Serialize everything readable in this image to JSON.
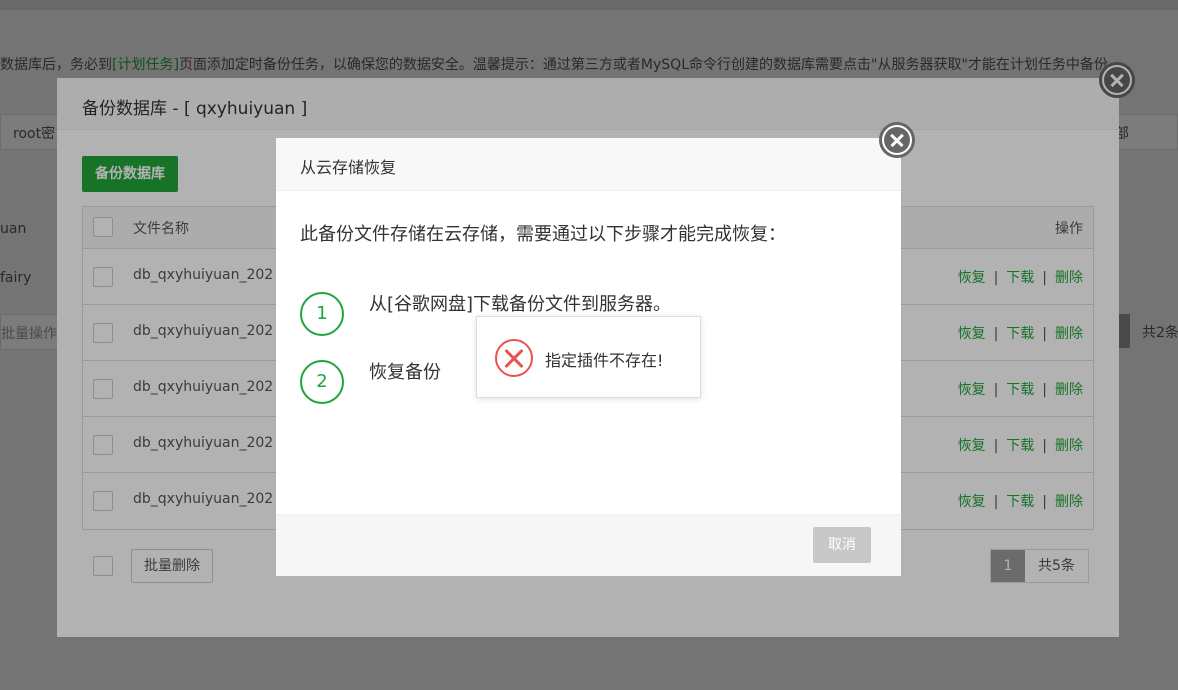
{
  "background": {
    "notice_prefix": "数据库后，务必到",
    "notice_link": "[计划任务]",
    "notice_suffix": "页面添加定时备份任务，以确保您的数据安全。温馨提示：通过第三方或者MySQL命令行创建的数据库需要点击\"从服务器获取\"才能在计划任务中备份",
    "search_fragment": "root密",
    "right_fragment": "部",
    "row_fragments": [
      "uan",
      "fairy",
      "批量操作"
    ],
    "right_pager_text": "共2条"
  },
  "outer_modal": {
    "title": "备份数据库 - [ qxyhuiyuan ]",
    "backup_button": "备份数据库",
    "columns": {
      "filename": "文件名称",
      "actions": "操作"
    },
    "rows": [
      {
        "filename": "db_qxyhuiyuan_202"
      },
      {
        "filename": "db_qxyhuiyuan_202"
      },
      {
        "filename": "db_qxyhuiyuan_202"
      },
      {
        "filename": "db_qxyhuiyuan_202"
      },
      {
        "filename": "db_qxyhuiyuan_202"
      }
    ],
    "row_actions": {
      "restore": "恢复",
      "download": "下载",
      "delete": "删除",
      "separator": "|"
    },
    "batch_delete": "批量删除",
    "pager": {
      "current": "1",
      "total": "共5条"
    }
  },
  "inner_modal": {
    "title": "从云存储恢复",
    "description": "此备份文件存储在云存储，需要通过以下步骤才能完成恢复：",
    "steps": [
      {
        "num": "1",
        "text": "从[谷歌网盘]下载备份文件到服务器。"
      },
      {
        "num": "2",
        "text": "恢复备份"
      }
    ],
    "cancel_button": "取消"
  },
  "toast": {
    "message": "指定插件不存在!"
  },
  "colors": {
    "accent": "#20a53a",
    "error": "#e9534f",
    "pager_active": "#9a9a9a"
  }
}
